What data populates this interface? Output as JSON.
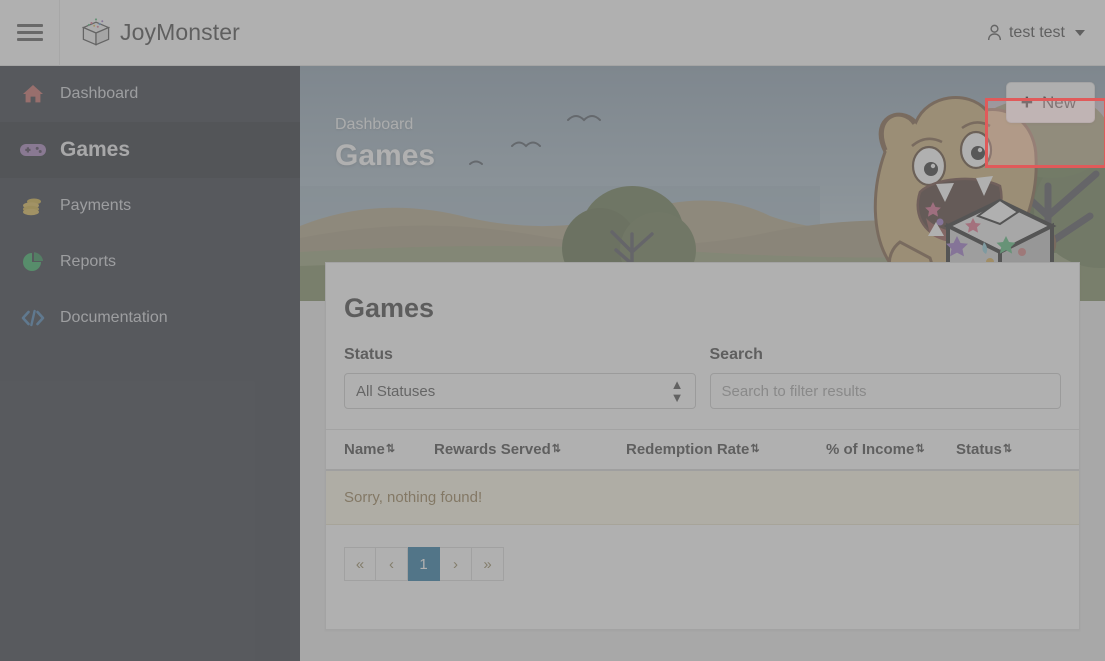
{
  "topbar": {
    "menu_icon": "hamburger-icon",
    "brand_logo_icon": "joymonster-box-logo",
    "brand_joy": "Joy",
    "brand_monster": "Monster",
    "user_icon": "user-icon",
    "user_name": "test test",
    "caret_icon": "chevron-down-icon"
  },
  "sidebar": {
    "items": [
      {
        "label": "Dashboard",
        "icon": "home-icon",
        "color": "#c0564f",
        "active": false
      },
      {
        "label": "Games",
        "icon": "gamepad-icon",
        "color": "#9a6fb0",
        "active": true
      },
      {
        "label": "Payments",
        "icon": "coins-icon",
        "color": "#c9a227",
        "active": false
      },
      {
        "label": "Reports",
        "icon": "pie-chart-icon",
        "color": "#17a24a",
        "active": false
      },
      {
        "label": "Documentation",
        "icon": "code-icon",
        "color": "#2d6fa8",
        "active": false
      }
    ]
  },
  "hero": {
    "breadcrumb": "Dashboard",
    "title": "Games",
    "new_button_label": "New",
    "new_button_plus": "+",
    "highlight_color": "#e05a5a"
  },
  "card": {
    "title": "Games",
    "filters": {
      "status_label": "Status",
      "status_value": "All Statuses",
      "status_options": [
        "All Statuses"
      ],
      "search_label": "Search",
      "search_value": "",
      "search_placeholder": "Search to filter results"
    },
    "table": {
      "columns": [
        "Name",
        "Rewards Served",
        "Redemption Rate",
        "% of Income",
        "Status"
      ],
      "sort_icon": "sort-updown-icon",
      "rows": [],
      "empty_message": "Sorry, nothing found!"
    },
    "pagination": {
      "first": "«",
      "prev": "‹",
      "pages": [
        "1"
      ],
      "active_page": "1",
      "next": "›",
      "last": "»",
      "active_color": "#0a6496"
    }
  }
}
